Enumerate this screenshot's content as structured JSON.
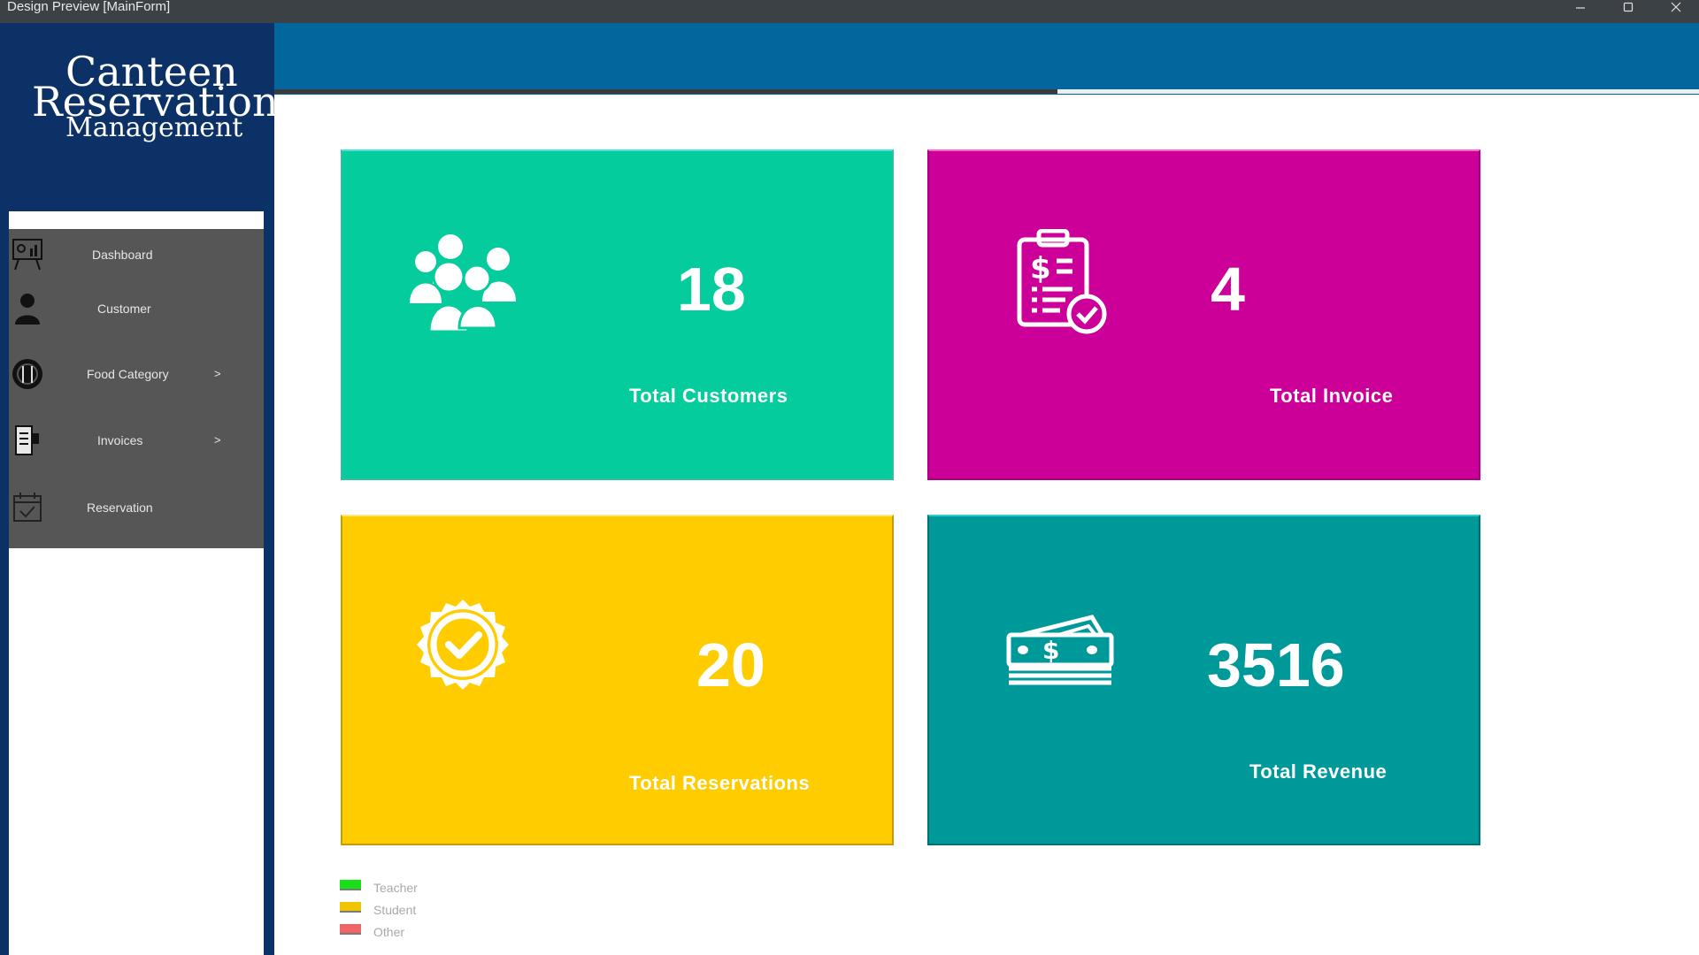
{
  "window": {
    "title": "Design Preview [MainForm]"
  },
  "logo": {
    "line1": "Canteen",
    "line2": "Reservation",
    "line3": "Management"
  },
  "nav": {
    "items": [
      {
        "label": "Dashboard",
        "arrow": ""
      },
      {
        "label": "Customer",
        "arrow": ""
      },
      {
        "label": "Food Category",
        "arrow": ">"
      },
      {
        "label": "Invoices",
        "arrow": ">"
      },
      {
        "label": "Reservation",
        "arrow": ""
      }
    ]
  },
  "cards": {
    "customers": {
      "value": "18",
      "label": "Total Customers",
      "color": "#04cc9c",
      "icon": "users-icon"
    },
    "invoice": {
      "value": "4",
      "label": "Total Invoice",
      "color": "#cc0099",
      "icon": "invoice-clipboard-icon"
    },
    "reservations": {
      "value": "20",
      "label": "Total Reservations",
      "color": "#ffcc00",
      "icon": "check-badge-icon"
    },
    "revenue": {
      "value": "3516",
      "label": "Total Revenue",
      "color": "#009999",
      "icon": "money-stack-icon"
    }
  },
  "legend": [
    {
      "label": "Teacher",
      "color": "#18e018"
    },
    {
      "label": "Student",
      "color": "#f0c400"
    },
    {
      "label": "Other",
      "color": "#f06464"
    }
  ],
  "colors": {
    "sidebar": "#0b3166",
    "header": "#03669d",
    "nav": "#565656"
  }
}
